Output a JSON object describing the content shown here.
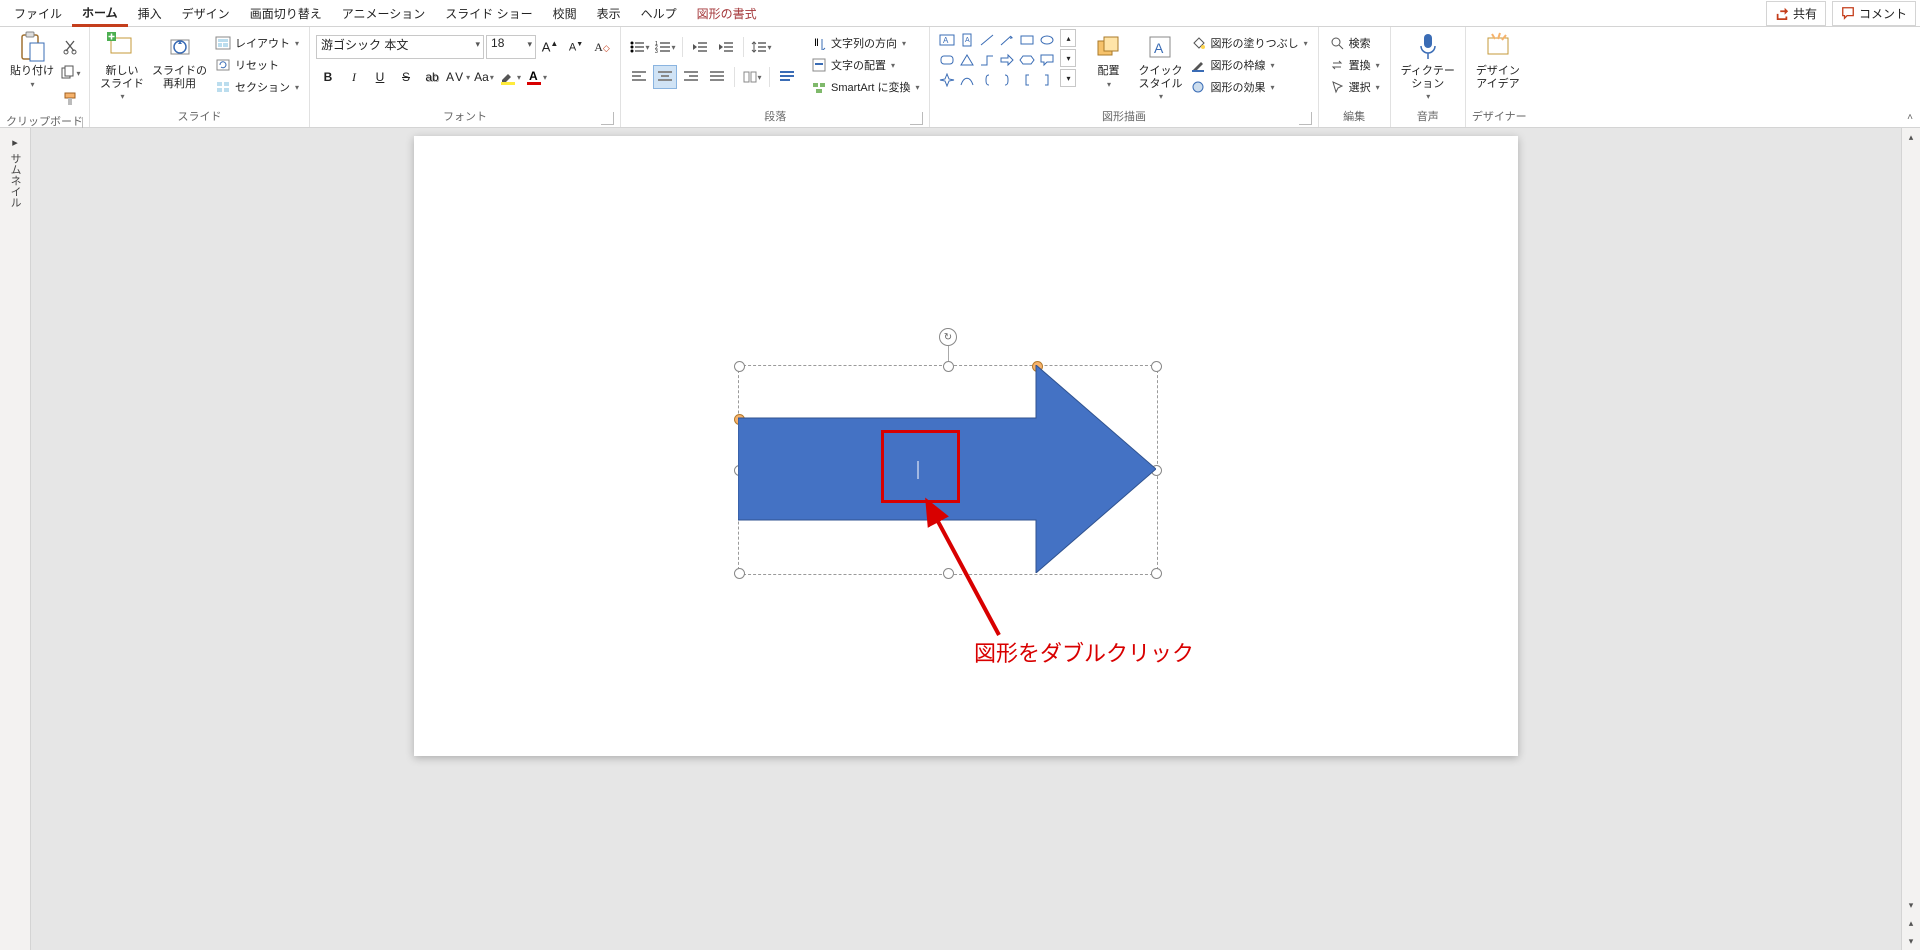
{
  "tabs": {
    "items": [
      "ファイル",
      "ホーム",
      "挿入",
      "デザイン",
      "画面切り替え",
      "アニメーション",
      "スライド ショー",
      "校閲",
      "表示",
      "ヘルプ",
      "図形の書式"
    ],
    "active_index": 1,
    "context_index": 10,
    "share": "共有",
    "comment": "コメント"
  },
  "groups": {
    "clipboard": {
      "label": "クリップボード",
      "paste": "貼り付け"
    },
    "slides": {
      "label": "スライド",
      "new_slide": "新しい\nスライド",
      "reuse": "スライドの\n再利用",
      "layout": "レイアウト",
      "reset": "リセット",
      "section": "セクション"
    },
    "font": {
      "label": "フォント",
      "name": "游ゴシック 本文",
      "size": "18"
    },
    "paragraph": {
      "label": "段落",
      "text_direction": "文字列の方向",
      "text_align": "文字の配置",
      "smartart": "SmartArt に変換"
    },
    "drawing": {
      "label": "図形描画",
      "arrange": "配置",
      "quick_styles": "クイック\nスタイル",
      "fill": "図形の塗りつぶし",
      "outline": "図形の枠線",
      "effects": "図形の効果"
    },
    "editing": {
      "label": "編集",
      "find": "検索",
      "replace": "置換",
      "select": "選択"
    },
    "voice": {
      "label": "音声",
      "dictate": "ディクテー\nション"
    },
    "designer": {
      "label": "デザイナー",
      "idea": "デザイン\nアイデア"
    }
  },
  "thumb": {
    "label": "サムネイル"
  },
  "annotation": {
    "text": "図形をダブルクリック"
  },
  "colors": {
    "accent": "#c43e1c",
    "shape_fill": "#4472c4",
    "annot": "#d80000"
  }
}
